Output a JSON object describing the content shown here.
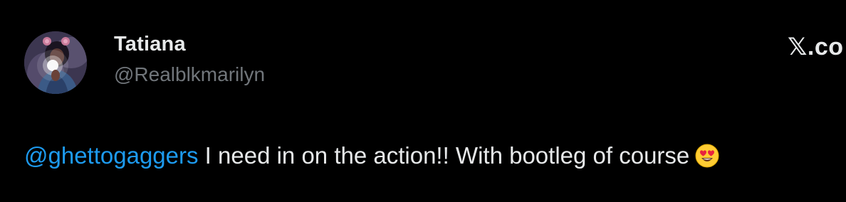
{
  "author": {
    "display_name": "Tatiana",
    "handle": "@Realblkmarilyn"
  },
  "brand": {
    "x_glyph": "𝕏",
    "domain_suffix": ".co"
  },
  "tweet": {
    "mention": "@ghettogaggers",
    "text": " I need in on the action!! With bootleg of course",
    "emoji_icon": "heart-eyes-emoji-icon"
  },
  "colors": {
    "background": "#000000",
    "primary_text": "#e7e9ea",
    "secondary_text": "#71767b",
    "link": "#1d9bf0"
  }
}
